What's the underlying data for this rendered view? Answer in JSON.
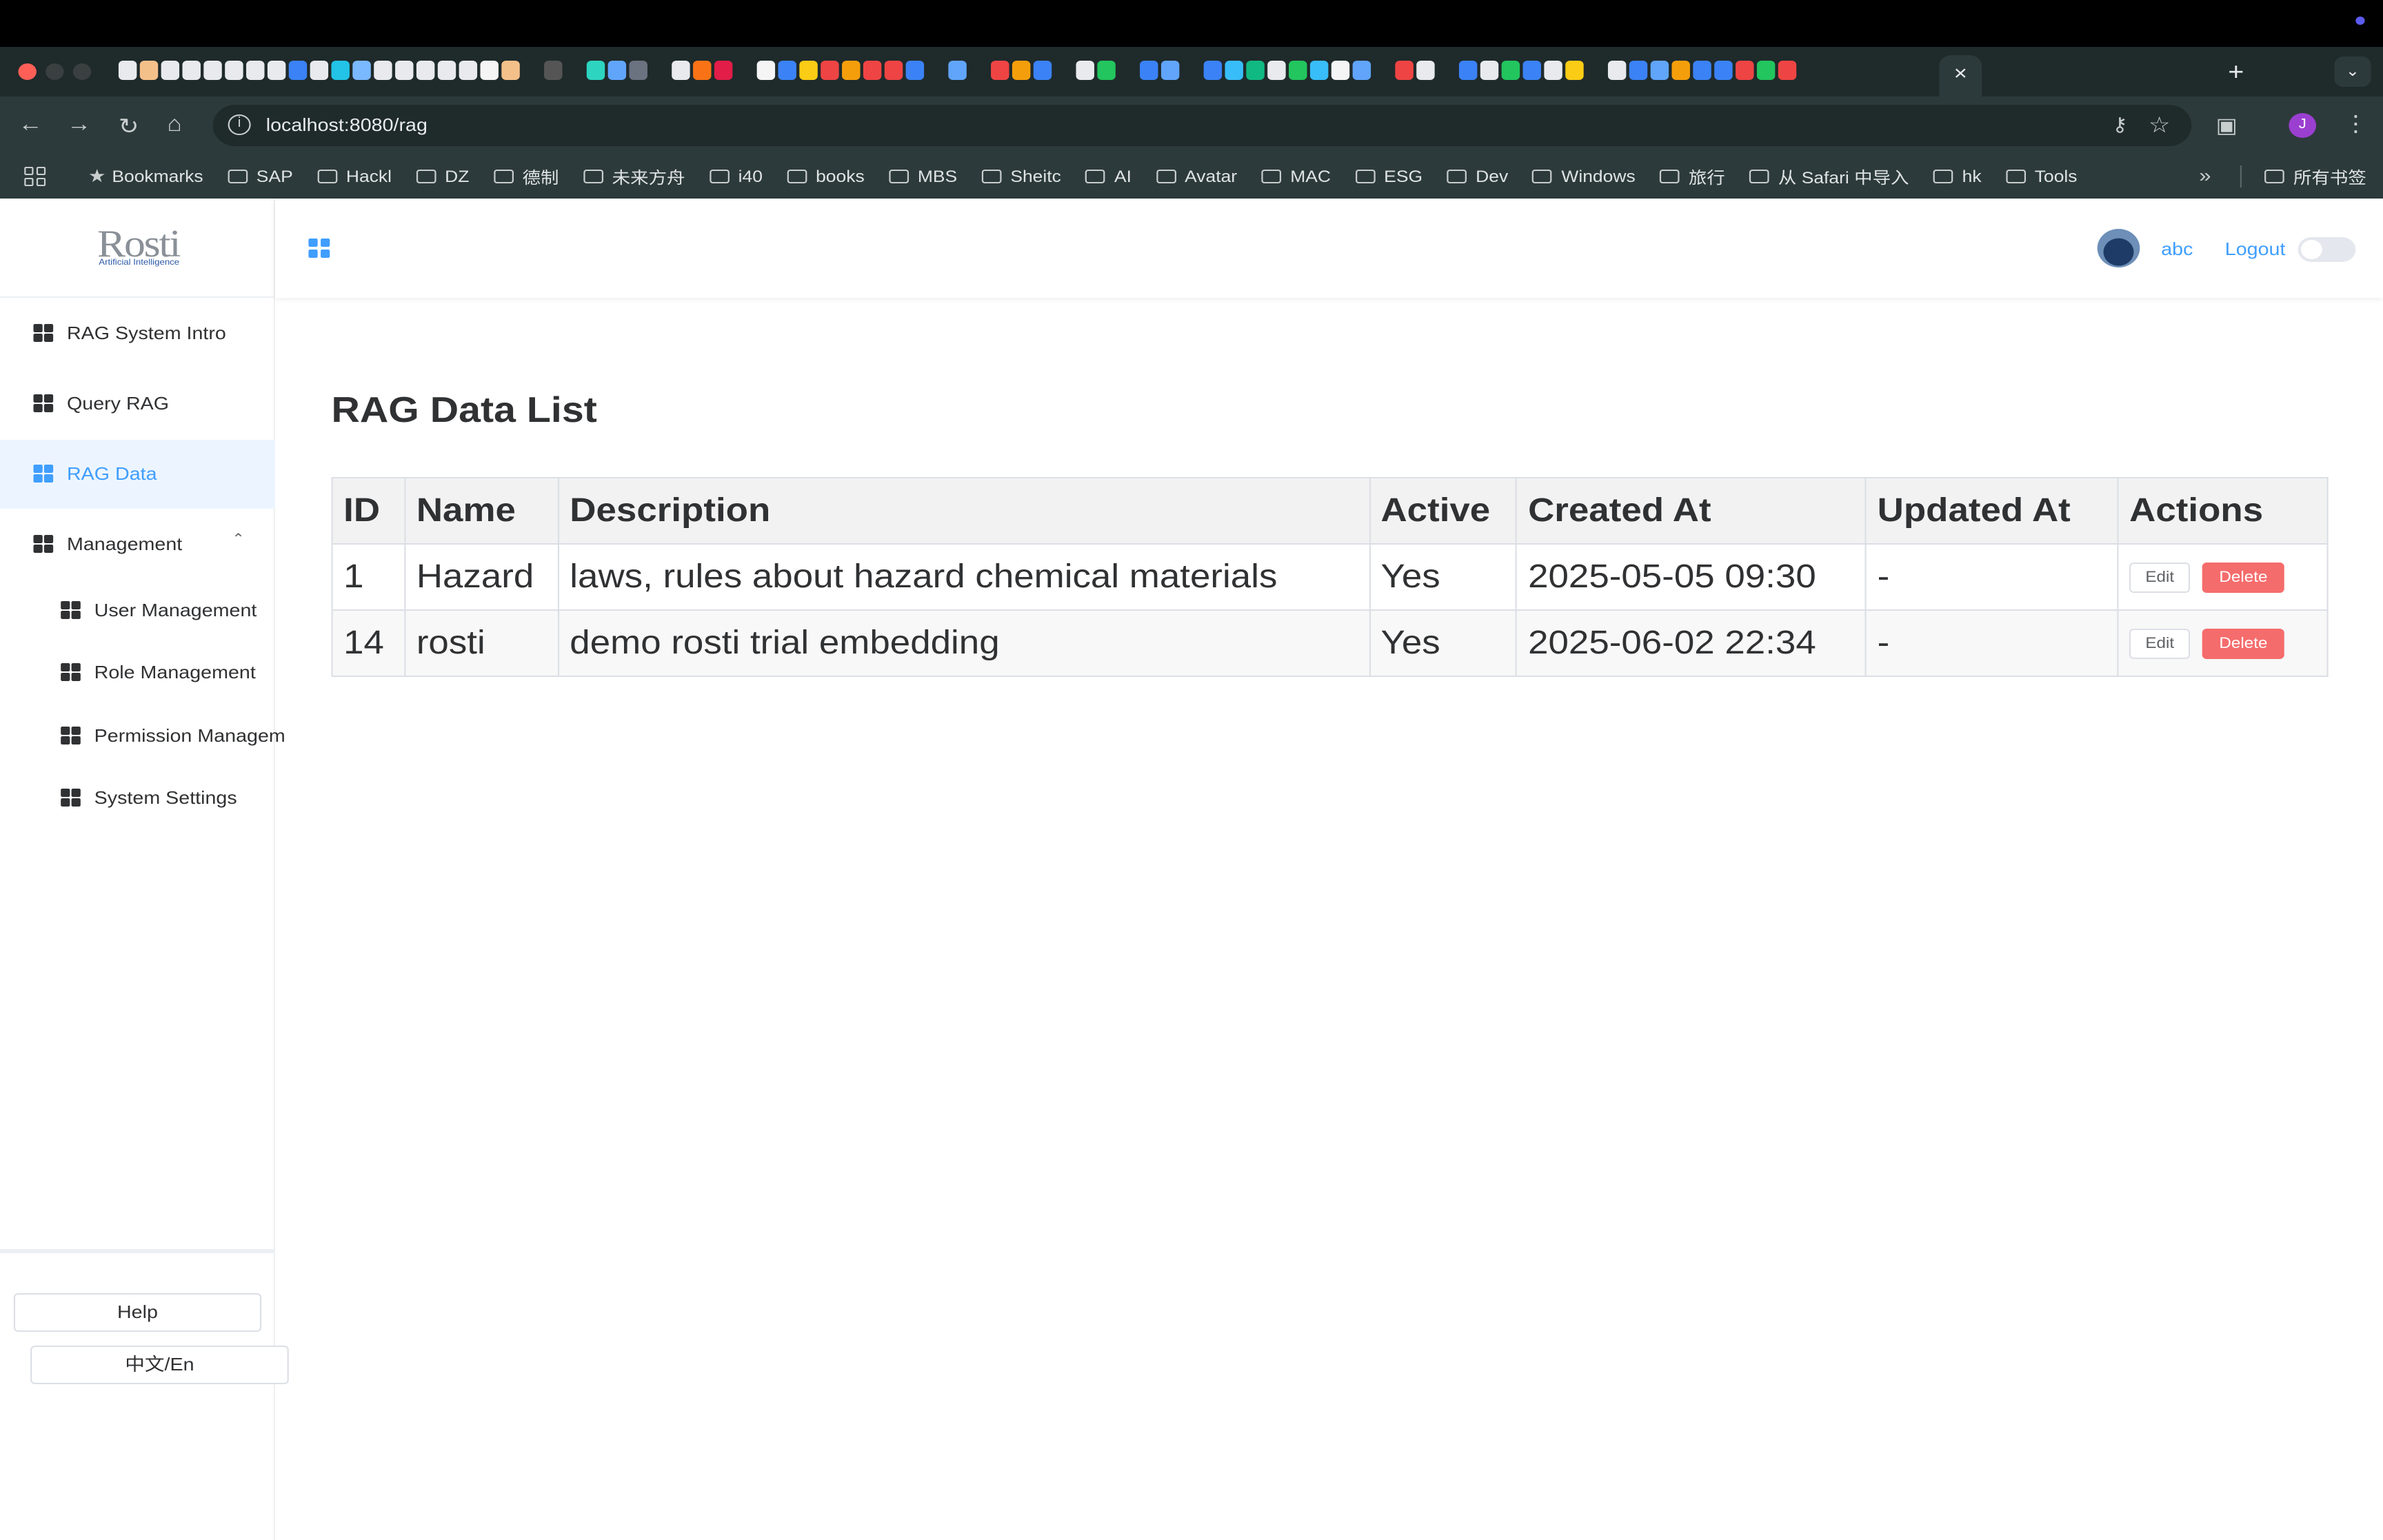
{
  "browser": {
    "url": "localhost:8080/rag",
    "profile_initial": "J",
    "tab_close": "×",
    "new_tab": "+",
    "bookmarks": [
      {
        "label": "Bookmarks",
        "icon": "star-icon"
      },
      {
        "label": "SAP",
        "icon": "folder-icon"
      },
      {
        "label": "Hackl",
        "icon": "folder-icon"
      },
      {
        "label": "DZ",
        "icon": "folder-icon"
      },
      {
        "label": "德制",
        "icon": "folder-icon"
      },
      {
        "label": "未来方舟",
        "icon": "folder-icon"
      },
      {
        "label": "i40",
        "icon": "folder-icon"
      },
      {
        "label": "books",
        "icon": "folder-icon"
      },
      {
        "label": "MBS",
        "icon": "folder-icon"
      },
      {
        "label": "Sheitc",
        "icon": "folder-icon"
      },
      {
        "label": "AI",
        "icon": "folder-icon"
      },
      {
        "label": "Avatar",
        "icon": "folder-icon"
      },
      {
        "label": "MAC",
        "icon": "folder-icon"
      },
      {
        "label": "ESG",
        "icon": "folder-icon"
      },
      {
        "label": "Dev",
        "icon": "folder-icon"
      },
      {
        "label": "Windows",
        "icon": "folder-icon"
      },
      {
        "label": "旅行",
        "icon": "folder-icon"
      },
      {
        "label": "从 Safari 中导入",
        "icon": "folder-icon"
      },
      {
        "label": "hk",
        "icon": "folder-icon"
      },
      {
        "label": "Tools",
        "icon": "folder-icon"
      }
    ],
    "all_bookmarks": "所有书签",
    "more": "»"
  },
  "app": {
    "logo": {
      "name": "Rosti",
      "tagline": "Artificial Intelligence"
    },
    "sidebar": {
      "items": [
        {
          "label": "RAG System Intro",
          "active": false
        },
        {
          "label": "Query RAG",
          "active": false
        },
        {
          "label": "RAG Data",
          "active": true
        },
        {
          "label": "Management",
          "active": false,
          "expanded": true
        }
      ],
      "subitems": [
        {
          "label": "User Management"
        },
        {
          "label": "Role Management"
        },
        {
          "label": "Permission Managem"
        },
        {
          "label": "System Settings"
        }
      ],
      "help": "Help",
      "lang": "中文/En"
    },
    "header": {
      "user": "abc",
      "logout": "Logout"
    },
    "page": {
      "title": "RAG Data List",
      "columns": [
        "ID",
        "Name",
        "Description",
        "Active",
        "Created At",
        "Updated At",
        "Actions"
      ],
      "rows": [
        {
          "id": "1",
          "name": "Hazard",
          "description": "laws, rules about hazard chemical materials",
          "active": "Yes",
          "created": "2025-05-05 09:30",
          "updated": "-"
        },
        {
          "id": "14",
          "name": "rosti",
          "description": "demo rosti trial embedding",
          "active": "Yes",
          "created": "2025-06-02 22:34",
          "updated": "-"
        }
      ],
      "edit_label": "Edit",
      "delete_label": "Delete"
    }
  },
  "colors": {
    "accent": "#409eff",
    "danger": "#f56c6c",
    "chrome": "#2d3a3b"
  }
}
